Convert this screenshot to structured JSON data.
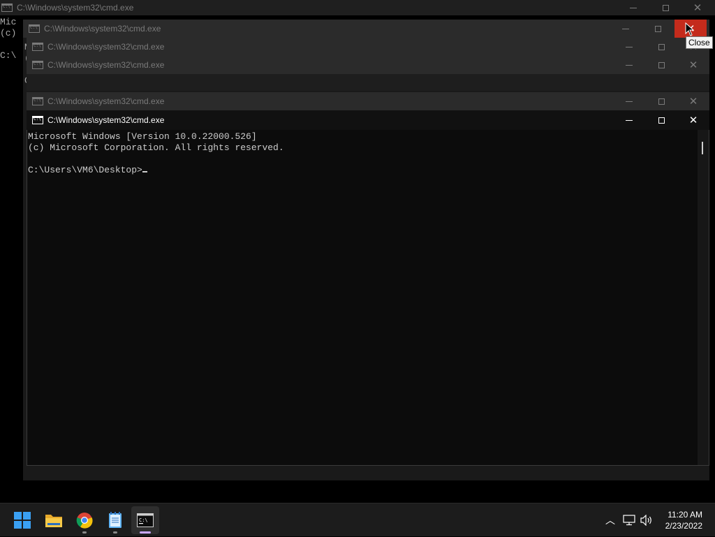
{
  "windows": {
    "background_window": {
      "title": "C:\\Windows\\system32\\cmd.exe",
      "text_lines": [
        "Mic",
        "(c)",
        "",
        "C:\\"
      ]
    },
    "stacked_windows": [
      {
        "title": "C:\\Windows\\system32\\cmd.exe"
      },
      {
        "title": "C:\\Windows\\system32\\cmd.exe"
      },
      {
        "title": "C:\\Windows\\system32\\cmd.exe"
      },
      {
        "title": "C:\\Windows\\system32\\cmd.exe"
      }
    ],
    "peek_chars": [
      "M",
      "(",
      "C"
    ],
    "active_window": {
      "title": "C:\\Windows\\system32\\cmd.exe",
      "console": {
        "line1": "Microsoft Windows [Version 10.0.22000.526]",
        "line2": "(c) Microsoft Corporation. All rights reserved.",
        "line3": "",
        "prompt": "C:\\Users\\VM6\\Desktop>"
      }
    },
    "tooltip": "Close",
    "icons": {
      "minimize": "minimize-icon",
      "maximize": "maximize-icon",
      "close": "close-icon",
      "app": "cmd-app-icon"
    }
  },
  "taskbar": {
    "apps": [
      {
        "name": "start-button",
        "icon": "windows-logo-icon"
      },
      {
        "name": "file-explorer",
        "icon": "folder-icon"
      },
      {
        "name": "chrome",
        "icon": "chrome-icon"
      },
      {
        "name": "notepad",
        "icon": "notepad-icon"
      },
      {
        "name": "command-prompt",
        "icon": "cmd-icon"
      }
    ],
    "tray": {
      "chevron": "chevron-up-icon",
      "network": "network-icon",
      "volume": "volume-icon"
    },
    "time": "11:20 AM",
    "date": "2/23/2022"
  },
  "colors": {
    "close_hover": "#c42b1c",
    "focus_indicator": "#c9a6ff"
  }
}
